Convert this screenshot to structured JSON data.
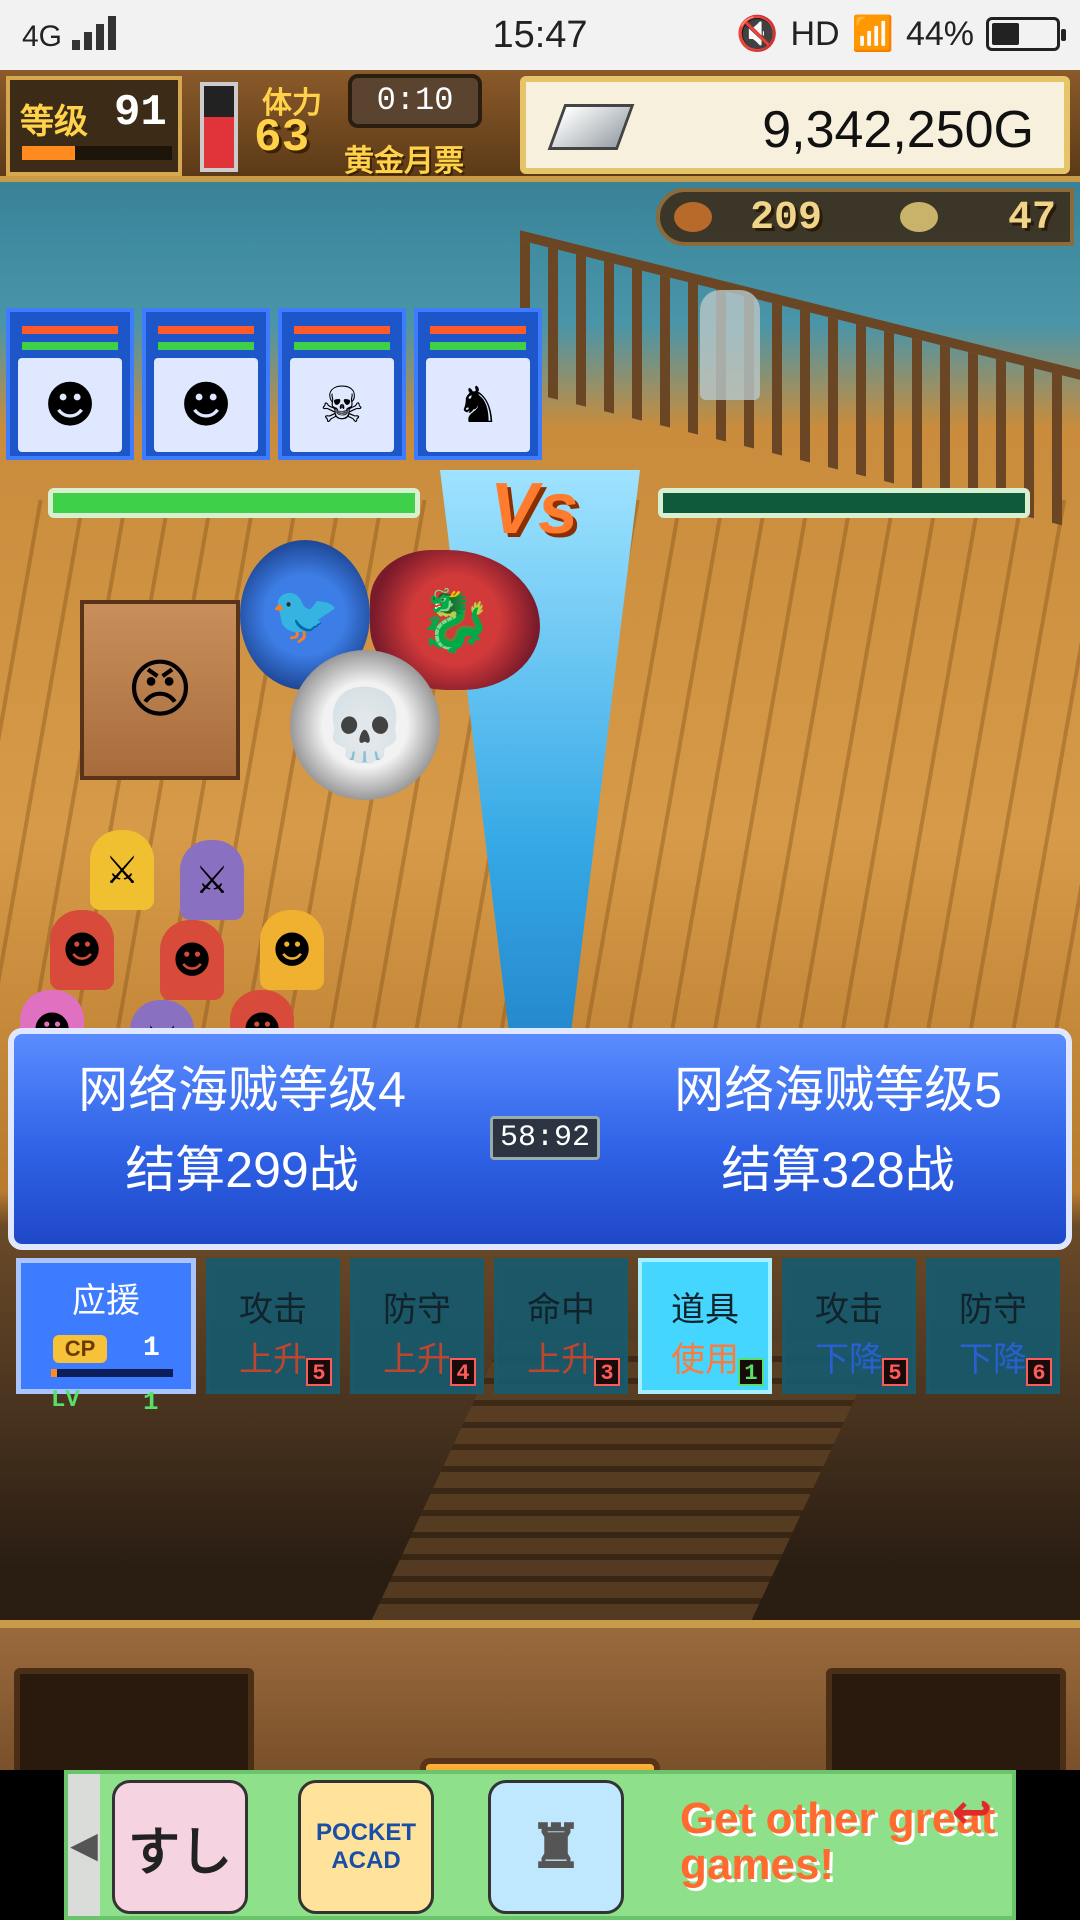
{
  "status_bar": {
    "network": "4G",
    "time": "15:47",
    "hd": "HD",
    "battery": "44%",
    "battery_level": 0.44
  },
  "hud": {
    "level_label": "等级",
    "level": "91",
    "level_progress": 0.35,
    "stamina_label": "体力",
    "stamina": "63",
    "stamina_fill": 0.62,
    "timer": "0:10",
    "event": "黄金月票",
    "gold": "9,342,250G",
    "food": "209",
    "medals": "47"
  },
  "party": [
    {
      "icon": "pirate-icon",
      "glyph": "☻"
    },
    {
      "icon": "pirate-icon",
      "glyph": "☻"
    },
    {
      "icon": "skull-icon",
      "glyph": "☠"
    },
    {
      "icon": "dragon-icon",
      "glyph": "♞"
    }
  ],
  "battle": {
    "vs": "Vs",
    "left_hp": 1.0,
    "right_hp": 1.0
  },
  "match": {
    "left_name": "网络海贼等级4",
    "left_record": "结算299战",
    "right_name": "网络海贼等级5",
    "right_record": "结算328战",
    "timer": "58:92"
  },
  "cheer": {
    "title": "应援",
    "cp_label": "CP",
    "cp_value": "1",
    "cp_progress": 0.05,
    "lv_label": "LV",
    "lv_value": "1"
  },
  "commands": [
    {
      "line1": "攻击",
      "line2": "上升",
      "count": "5",
      "color": "#c0452e",
      "active": false
    },
    {
      "line1": "防守",
      "line2": "上升",
      "count": "4",
      "color": "#c0452e",
      "active": false
    },
    {
      "line1": "命中",
      "line2": "上升",
      "count": "3",
      "color": "#c0452e",
      "active": false
    },
    {
      "line1": "道具",
      "line2": "使用",
      "count": "1",
      "color": "#ff7a3a",
      "active": true
    },
    {
      "line1": "攻击",
      "line2": "下降",
      "count": "5",
      "color": "#2a5fd0",
      "active": false
    },
    {
      "line1": "防守",
      "line2": "下降",
      "count": "6",
      "color": "#2a5fd0",
      "active": false
    }
  ],
  "ad": {
    "icon1": "すし",
    "icon2": "POCKET ACAD",
    "icon3": "♜",
    "text": "Get other great games!"
  }
}
